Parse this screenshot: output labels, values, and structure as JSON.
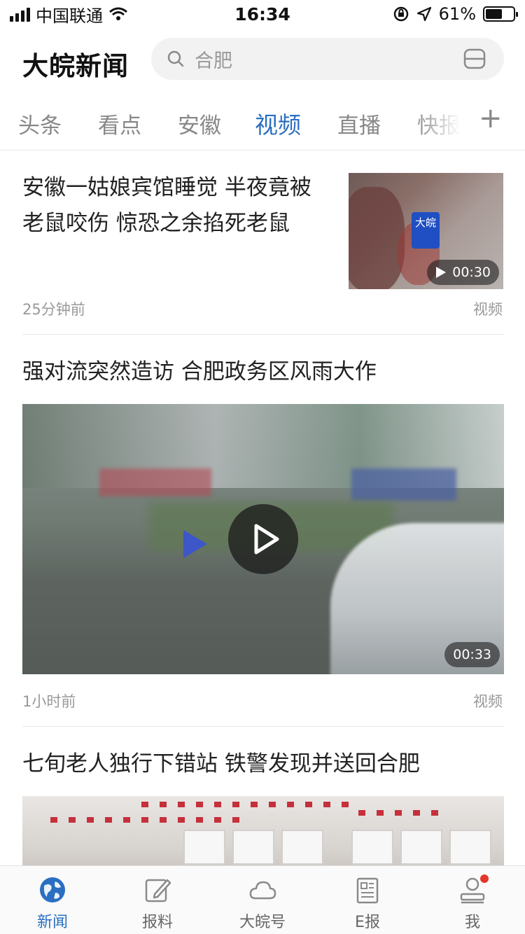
{
  "status_bar": {
    "carrier": "中国联通",
    "time": "16:34",
    "battery_percent": "61%",
    "battery_level": 0.61,
    "icons": [
      "signal-icon",
      "wifi-icon",
      "orientation-lock-icon",
      "location-icon",
      "battery-icon"
    ]
  },
  "header": {
    "app_title": "大皖新闻",
    "search_placeholder": "合肥",
    "icons": [
      "search-icon",
      "scan-icon"
    ]
  },
  "tabs": {
    "items": [
      "头条",
      "看点",
      "安徽",
      "视频",
      "直播",
      "快报"
    ],
    "active": "视频",
    "add_icon": "+"
  },
  "articles": [
    {
      "title": "安徽一姑娘宾馆睡觉 半夜竟被老鼠咬伤 惊恐之余掐死老鼠",
      "time": "25分钟前",
      "category": "视频",
      "duration": "00:30",
      "thumb_logo": "大皖"
    },
    {
      "title": "强对流突然造访 合肥政务区风雨大作",
      "time": "1小时前",
      "category": "视频",
      "duration": "00:33"
    },
    {
      "title": "七旬老人独行下错站 铁警发现并送回合肥"
    }
  ],
  "bottom_nav": {
    "items": [
      {
        "label": "新闻",
        "icon": "globe-icon",
        "active": true
      },
      {
        "label": "报料",
        "icon": "edit-icon",
        "active": false
      },
      {
        "label": "大皖号",
        "icon": "cloud-icon",
        "active": false
      },
      {
        "label": "E报",
        "icon": "newspaper-icon",
        "active": false
      },
      {
        "label": "我",
        "icon": "user-icon",
        "active": false,
        "notification_dot": true
      }
    ]
  },
  "colors": {
    "accent": "#2a6fc2",
    "notification": "#e8352b"
  }
}
